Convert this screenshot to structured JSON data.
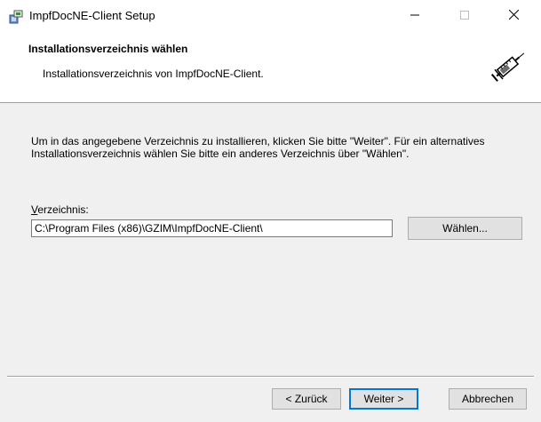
{
  "window": {
    "title": "ImpfDocNE-Client Setup"
  },
  "header": {
    "title": "Installationsverzeichnis wählen",
    "subtitle": "Installationsverzeichnis von ImpfDocNE-Client."
  },
  "main": {
    "description": "Um in das angegebene Verzeichnis zu installieren, klicken Sie bitte \"Weiter\". Für ein alternatives Installationsverzeichnis wählen Sie bitte ein anderes Verzeichnis über \"Wählen\".",
    "directory_label_access": "V",
    "directory_label_rest": "erzeichnis:",
    "directory_value": "C:\\Program Files (x86)\\GZIM\\ImpfDocNE-Client\\",
    "browse_label": "Wählen..."
  },
  "footer": {
    "back_label": "< Zurück",
    "next_label": "Weiter >",
    "cancel_label": "Abbrechen"
  },
  "colors": {
    "accent": "#0078d7",
    "window_bg": "#f0f0f0",
    "header_bg": "#ffffff"
  },
  "icons": [
    "installer-icon",
    "minimize-icon",
    "maximize-icon",
    "close-icon",
    "syringe-icon"
  ]
}
